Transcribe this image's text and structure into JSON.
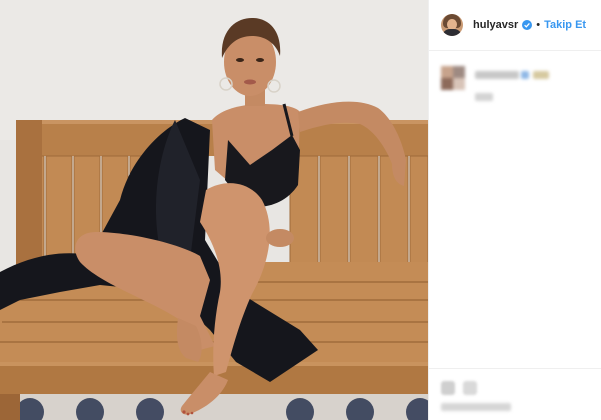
{
  "post": {
    "username": "hulyavsr",
    "separator": "•",
    "follow_label": "Takip Et",
    "verified": true
  },
  "colors": {
    "accent": "#3897f0",
    "text": "#262626",
    "divider": "#efefef"
  },
  "icons": {
    "verified": "verified-badge-icon",
    "avatar": "profile-avatar"
  }
}
